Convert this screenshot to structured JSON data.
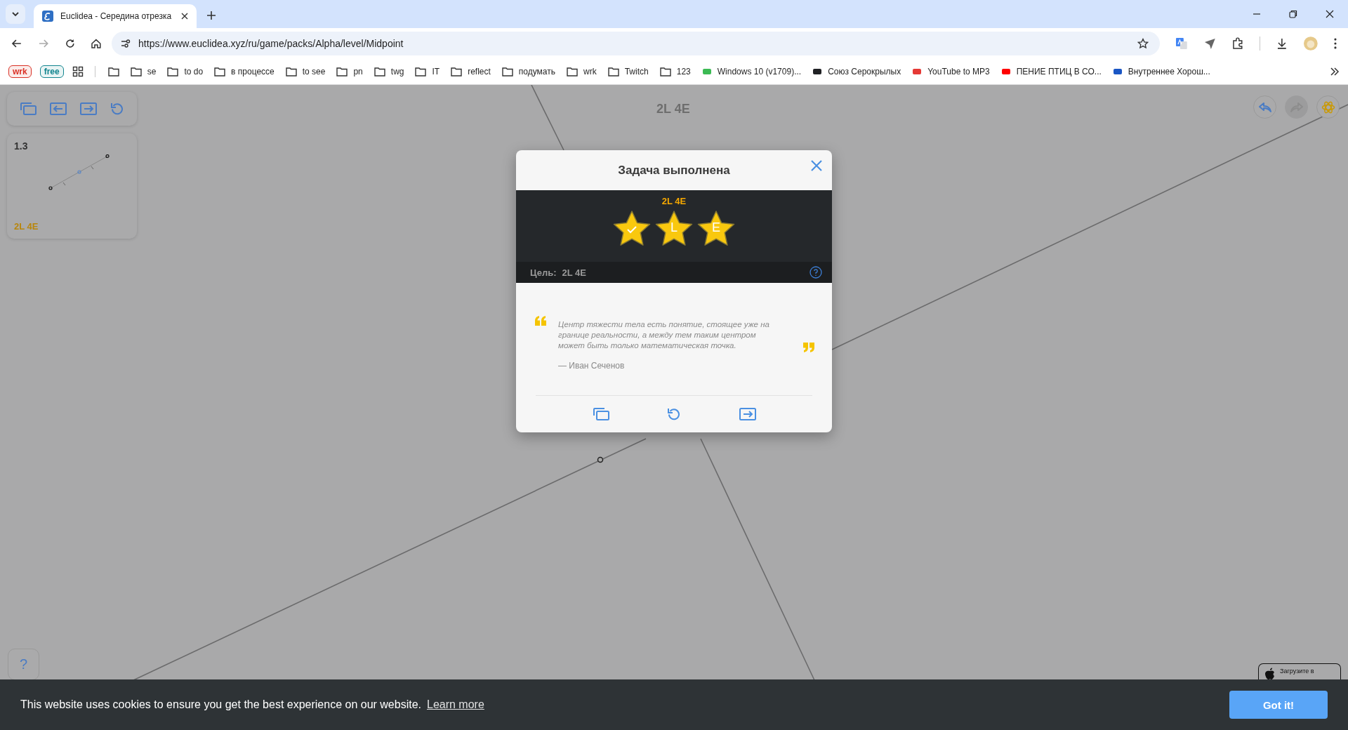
{
  "browser": {
    "tab": {
      "title": "Euclidea - Середина отрезка",
      "selected": true
    },
    "url": "https://www.euclidea.xyz/ru/game/packs/Alpha/level/Midpoint",
    "bookmarks": [
      {
        "kind": "badge",
        "label": "wrk",
        "color": "#d93025"
      },
      {
        "kind": "badge",
        "label": "free",
        "color": "#12858f"
      },
      {
        "kind": "apps"
      },
      {
        "kind": "folder"
      },
      {
        "kind": "folder",
        "label": "se"
      },
      {
        "kind": "folder",
        "label": "to do"
      },
      {
        "kind": "folder",
        "label": "в процессе"
      },
      {
        "kind": "folder",
        "label": "to see"
      },
      {
        "kind": "folder",
        "label": "pn"
      },
      {
        "kind": "folder",
        "label": "twg"
      },
      {
        "kind": "folder",
        "label": "IT"
      },
      {
        "kind": "folder",
        "label": "reflect"
      },
      {
        "kind": "folder",
        "label": "подумать"
      },
      {
        "kind": "folder",
        "label": "wrk"
      },
      {
        "kind": "folder",
        "label": "Twitch"
      },
      {
        "kind": "folder",
        "label": "123"
      },
      {
        "kind": "site",
        "label": "Windows 10 (v1709)...",
        "color": "#3cba54"
      },
      {
        "kind": "site",
        "label": "Союз Серокрылых",
        "color": "#202124"
      },
      {
        "kind": "site",
        "label": "YouTube to MP3",
        "color": "#e53935"
      },
      {
        "kind": "site",
        "label": "ПЕНИЕ ПТИЦ В СО...",
        "color": "#ff0000"
      },
      {
        "kind": "site",
        "label": "Внутреннее Хорош...",
        "color": "#1a56c4"
      }
    ]
  },
  "game": {
    "level_header": "2L 4E",
    "history_buttons": [
      {
        "kind": "undo",
        "disabled": false
      },
      {
        "kind": "redo",
        "disabled": true
      },
      {
        "kind": "tools",
        "disabled": false
      }
    ],
    "level_card": {
      "number": "1.3",
      "goal": "2L 4E"
    },
    "help_label": "?",
    "app_store_caption": "Загрузите в"
  },
  "dialog": {
    "title": "Задача выполнена",
    "score": "2L 4E",
    "stars": 3,
    "star_marks": [
      {
        "kind": "check"
      },
      {
        "kind": "letter",
        "label": "L"
      },
      {
        "kind": "letter",
        "label": "E"
      }
    ],
    "goal_label": "Цель:",
    "goal_value": "2L 4E",
    "quote": "Центр тяжести тела есть понятие, стоящее уже на границе реальности, а между тем таким центром может быть только математическая точка.",
    "author": "— Иван Сеченов"
  },
  "cookie_banner": {
    "text": "This website uses cookies to ensure you get the best experience on our website.",
    "link": "Learn more",
    "button": "Got it!"
  }
}
